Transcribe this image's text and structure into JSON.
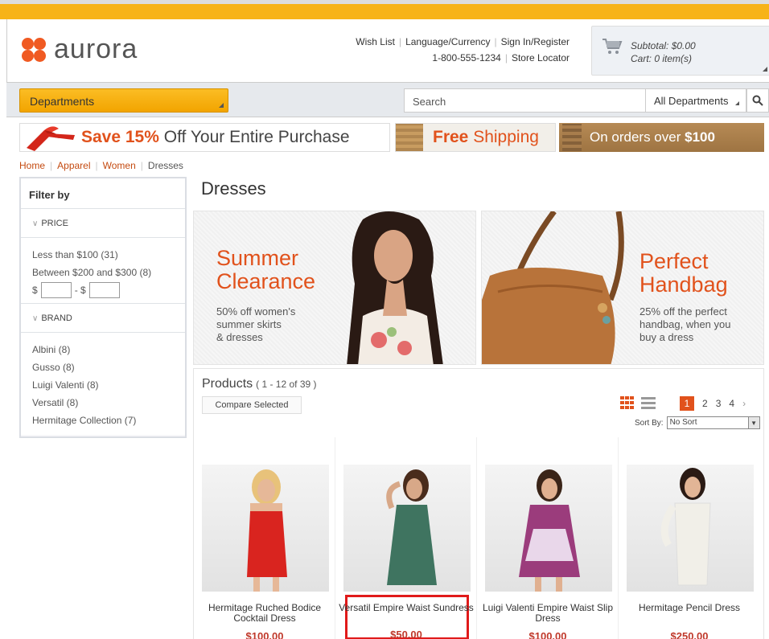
{
  "header": {
    "logo_text": "aurora",
    "links_row1": [
      "Wish List",
      "Language/Currency",
      "Sign In/Register"
    ],
    "links_row2": [
      "1-800-555-1234",
      "Store Locator"
    ],
    "cart": {
      "subtotal": "Subtotal: $0.00",
      "items": "Cart: 0 item(s)"
    }
  },
  "nav": {
    "departments_label": "Departments",
    "search_placeholder": "Search",
    "search_scope": "All Departments"
  },
  "promos": {
    "save_pct": "Save 15%",
    "save_rest": " Off Your Entire Purchase",
    "free_bold": "Free",
    "free_rest": " Shipping",
    "orders_text": "On orders over ",
    "orders_amount": "$100"
  },
  "breadcrumb": [
    "Home",
    "Apparel",
    "Women",
    "Dresses"
  ],
  "sidebar": {
    "title": "Filter by",
    "price_label": "PRICE",
    "price_options": [
      "Less than $100 (31)",
      "Between $200 and $300 (8)"
    ],
    "range_from": "$",
    "range_to": "- $",
    "brand_label": "BRAND",
    "brands": [
      "Albini (8)",
      "Gusso (8)",
      "Luigi Valenti (8)",
      "Versatil (8)",
      "Hermitage Collection (7)"
    ]
  },
  "page": {
    "title": "Dresses"
  },
  "banners": [
    {
      "headline1": "Summer",
      "headline2": "Clearance",
      "sub1": "50% off women's",
      "sub2": "summer skirts",
      "sub3": "& dresses"
    },
    {
      "headline1": "Perfect",
      "headline2": "Handbag",
      "sub1": "25% off the perfect",
      "sub2": "handbag, when you",
      "sub3": "buy a dress"
    }
  ],
  "products": {
    "title": "Products",
    "count": "( 1 - 12 of 39 )",
    "compare": "Compare Selected",
    "pages": [
      "1",
      "2",
      "3",
      "4"
    ],
    "sort_label": "Sort By:",
    "sort_value": "No Sort",
    "items": [
      {
        "name": "Hermitage Ruched Bodice Cocktail Dress",
        "price": "$100.00",
        "dress_color": "#d9241f"
      },
      {
        "name": "Versatil Empire Waist Sundress",
        "price": "$50.00",
        "dress_color": "#3f7460"
      },
      {
        "name": "Luigi Valenti Empire Waist Slip Dress",
        "price": "$100.00",
        "dress_color": "#9b3c7c"
      },
      {
        "name": "Hermitage Pencil Dress",
        "price": "$250.00",
        "dress_color": "#f1efe8"
      }
    ]
  },
  "colors": {
    "accent": "#e1521c",
    "brand_orange": "#f7b318"
  }
}
